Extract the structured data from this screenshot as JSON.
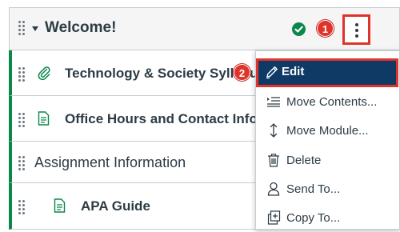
{
  "module": {
    "title": "Welcome!",
    "status_icon": "published-check-icon",
    "callout_1": "1"
  },
  "rows": [
    {
      "label": "Technology & Society Syllabus",
      "icon": "attachment-icon"
    },
    {
      "label": "Office Hours and Contact Info",
      "icon": "page-icon"
    },
    {
      "label": "Assignment Information"
    },
    {
      "label": "APA Guide",
      "icon": "page-icon"
    }
  ],
  "menu": {
    "callout_2": "2",
    "items": [
      {
        "label": "Edit",
        "icon": "pencil-icon"
      },
      {
        "label": "Move Contents...",
        "icon": "move-contents-icon"
      },
      {
        "label": "Move Module...",
        "icon": "vertical-arrows-icon"
      },
      {
        "label": "Delete",
        "icon": "trash-icon"
      },
      {
        "label": "Send To...",
        "icon": "user-icon"
      },
      {
        "label": "Copy To...",
        "icon": "copy-icon"
      }
    ]
  },
  "colors": {
    "accent_green": "#0b874b",
    "callout_red": "#e0342b",
    "highlight_blue": "#0f3a66"
  }
}
